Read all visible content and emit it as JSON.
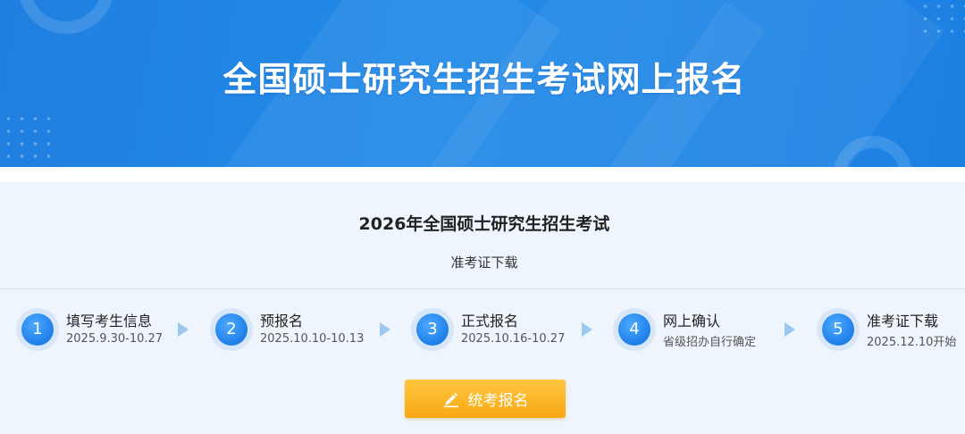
{
  "banner": {
    "title": "全国硕士研究生招生考试网上报名"
  },
  "exam": {
    "title": "2026年全国硕士研究生招生考试",
    "section": "准考证下载"
  },
  "steps": [
    {
      "number": "1",
      "name": "填写考生信息",
      "date": "2025.9.30-10.27"
    },
    {
      "number": "2",
      "name": "预报名",
      "date": "2025.10.10-10.13"
    },
    {
      "number": "3",
      "name": "正式报名",
      "date": "2025.10.16-10.27"
    },
    {
      "number": "4",
      "name": "网上确认",
      "date": "省级招办自行确定"
    },
    {
      "number": "5",
      "name": "准考证下载",
      "date": "2025.12.10开始"
    }
  ],
  "button": {
    "label": "统考报名",
    "icon": "pencil-icon"
  },
  "colors": {
    "banner_blue": "#238be8",
    "step_blue": "#1e7fe8",
    "arrow_blue": "#9ac8f0",
    "button_orange": "#f7a912",
    "page_bg": "#eef5fc"
  }
}
